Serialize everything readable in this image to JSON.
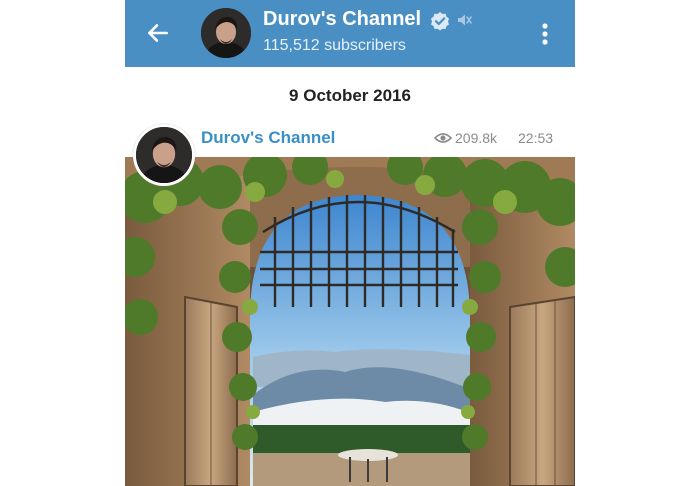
{
  "header": {
    "title": "Durov's Channel",
    "subscribers": "115,512 subscribers"
  },
  "date_separator": "9 October 2016",
  "post": {
    "author": "Durov's Channel",
    "views": "209.8k",
    "time": "22:53",
    "photo_subject": "gate-arch-landscape-photo"
  },
  "icons": {
    "back": "arrow-left-icon",
    "verified": "verified-check-icon",
    "muted": "muted-speaker-icon",
    "menu": "more-vertical-icon",
    "views": "eye-icon"
  },
  "colors": {
    "header_bg": "#4a8fc4",
    "author_name": "#3a8fc6",
    "meta_text": "#8b8b8b"
  }
}
